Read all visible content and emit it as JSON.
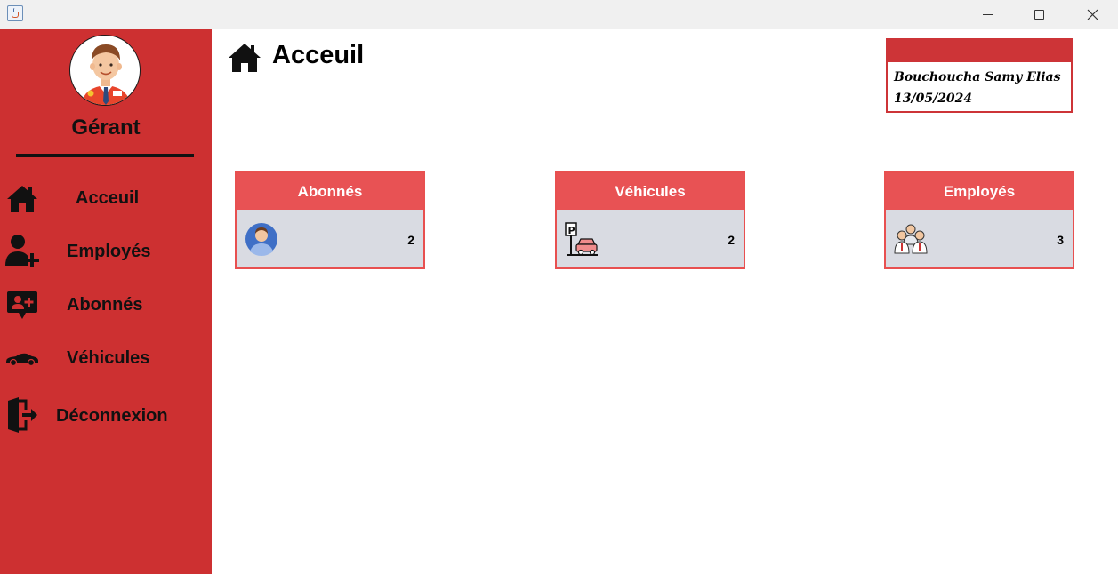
{
  "window": {
    "controls": [
      "minimize",
      "maximize",
      "close"
    ]
  },
  "sidebar": {
    "role": "Gérant",
    "items": [
      {
        "label": "Acceuil",
        "icon": "home-icon"
      },
      {
        "label": "Employés",
        "icon": "add-user-icon"
      },
      {
        "label": "Abonnés",
        "icon": "subscriber-chat-icon"
      },
      {
        "label": "Véhicules",
        "icon": "car-icon"
      },
      {
        "label": "Déconnexion",
        "icon": "logout-door-icon"
      }
    ],
    "color": "#cd3031"
  },
  "header": {
    "title": "Acceuil",
    "icon": "home-icon"
  },
  "user_card": {
    "name": "Bouchoucha Samy Elias",
    "date": "13/05/2024"
  },
  "stats": [
    {
      "title": "Abonnés",
      "count": "2",
      "icon": "subscriber-avatar-icon"
    },
    {
      "title": "Véhicules",
      "count": "2",
      "icon": "parking-car-icon"
    },
    {
      "title": "Employés",
      "count": "3",
      "icon": "employees-group-icon"
    }
  ],
  "colors": {
    "accent": "#cd3031",
    "card_header": "#e85254",
    "card_body": "#d9dbe2"
  }
}
